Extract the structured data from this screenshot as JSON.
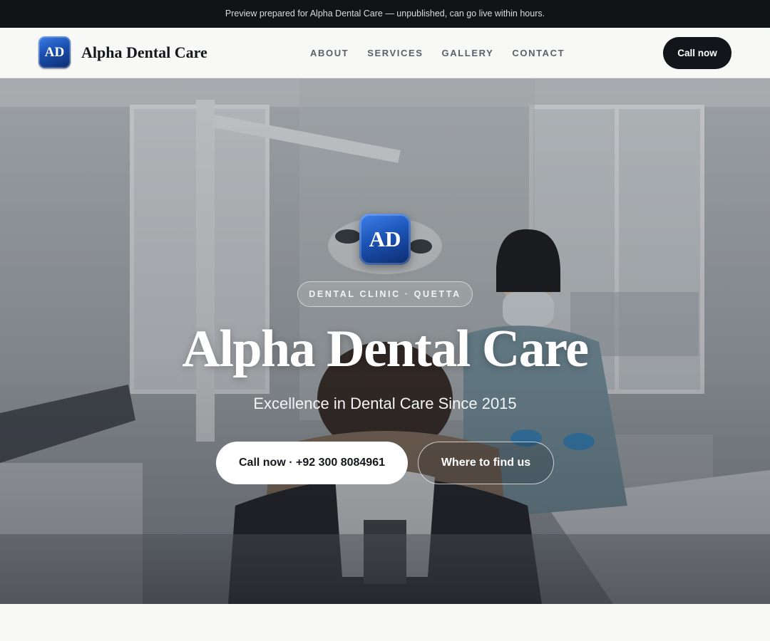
{
  "banner": {
    "text": "Preview prepared for Alpha Dental Care — unpublished, can go live within hours."
  },
  "header": {
    "logo_initials": "AD",
    "brand_name": "Alpha Dental Care",
    "nav": [
      {
        "label": "ABOUT"
      },
      {
        "label": "SERVICES"
      },
      {
        "label": "GALLERY"
      },
      {
        "label": "CONTACT"
      }
    ],
    "cta_label": "Call now"
  },
  "hero": {
    "logo_initials": "AD",
    "tagline": "DENTAL CLINIC · QUETTA",
    "title": "Alpha Dental Care",
    "subtitle": "Excellence in Dental Care Since 2015",
    "primary_button": "Call now · +92 300 8084961",
    "secondary_button": "Where to find us",
    "background_image": "dental-clinic-photo"
  },
  "colors": {
    "banner_bg": "#111317",
    "header_bg": "#f8f8f6",
    "accent_dark": "#13151a",
    "logo_blue": "#1c54b6"
  }
}
